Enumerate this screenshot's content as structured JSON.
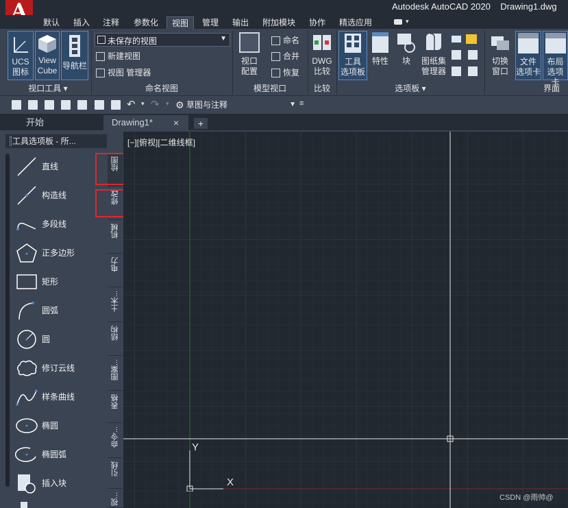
{
  "title_bar": {
    "app_name_title": "Autodesk AutoCAD 2020",
    "document_title": "Drawing1.dwg",
    "logo_letter": "A"
  },
  "menu": {
    "tabs": [
      "默认",
      "插入",
      "注释",
      "参数化",
      "视图",
      "管理",
      "输出",
      "附加模块",
      "协作",
      "精选应用"
    ],
    "active": "视图"
  },
  "ribbon": {
    "viewport_tools": {
      "panel_label": "视口工具",
      "ucs_label_1": "UCS",
      "ucs_label_2": "图标",
      "viewcube_label_1": "View",
      "viewcube_label_2": "Cube",
      "navbar_label": "导航栏"
    },
    "named_views": {
      "panel_label": "命名视图",
      "selected_view": "未保存的视图",
      "new_view": "新建视图",
      "view_manager": "视图 管理器"
    },
    "model_viewports": {
      "panel_label": "模型视口",
      "config_label_1": "视口",
      "config_label_2": "配置",
      "name_label": "命名",
      "join_label": "合并",
      "restore_label": "恢复"
    },
    "compare": {
      "panel_label": "比较",
      "dwg_label_1": "DWG",
      "dwg_label_2": "比较"
    },
    "palettes": {
      "panel_label": "选项板",
      "tool_palette_1": "工具",
      "tool_palette_2": "选项板",
      "properties": "特性",
      "block": "块",
      "sheet_set_1": "图纸集",
      "sheet_set_2": "管理器"
    },
    "interface": {
      "panel_label": "界面",
      "switch_1": "切换",
      "switch_2": "窗口",
      "file_tab_1": "文件",
      "file_tab_2": "选项卡",
      "layout_tab_1": "布局",
      "layout_tab_2": "选项卡"
    }
  },
  "quick_access": {
    "workspace": "草图与注释"
  },
  "doc_tabs": {
    "start": "开始",
    "drawing": "Drawing1*",
    "close": "×",
    "add": "+"
  },
  "tool_palette": {
    "title": "工具选项板 - 所...",
    "items": [
      "直线",
      "构造线",
      "多段线",
      "正多边形",
      "矩形",
      "圆弧",
      "圆",
      "修订云线",
      "样条曲线",
      "椭圆",
      "椭圆弧",
      "插入块"
    ],
    "tabs": [
      "绘图",
      "修改",
      "机械",
      "电力",
      "土木...",
      "结构",
      "图案...",
      "表格",
      "命令...",
      "引线",
      "视..."
    ]
  },
  "canvas": {
    "viewport_label": "[−][俯视][二维线框]",
    "ucs_y": "Y",
    "ucs_x": "X"
  },
  "watermark": "CSDN @雨帅@",
  "colors": {
    "accent_blue": "#5b8ac0",
    "logo_red": "#b71c1c",
    "highlight_red": "#e0262a",
    "canvas_bg": "#212830",
    "panel_bg": "#3b4453"
  }
}
